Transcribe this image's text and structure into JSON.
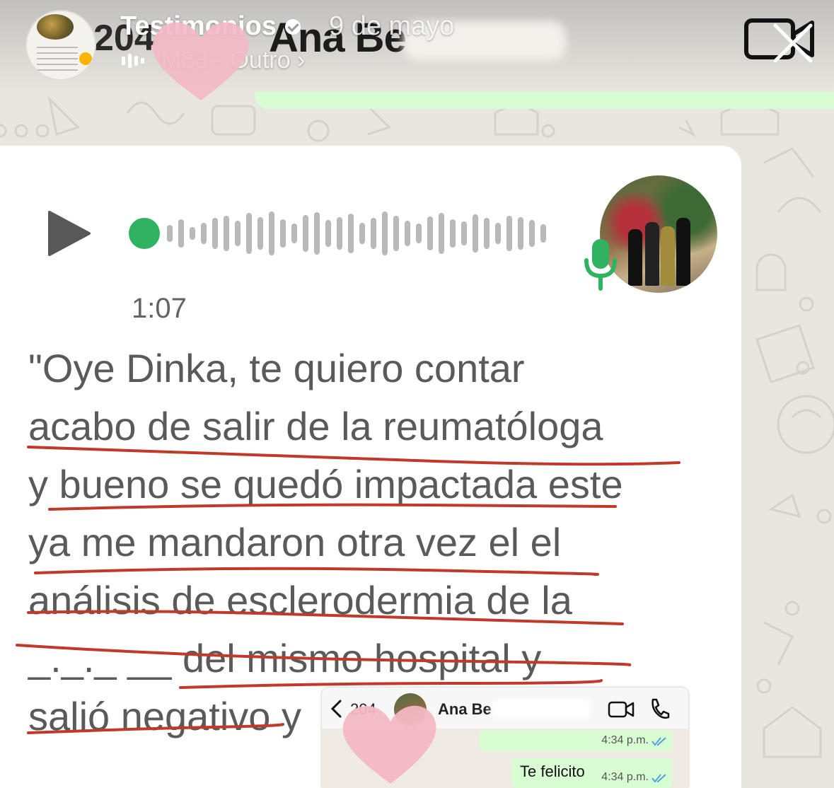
{
  "story": {
    "account_name": "Testimonios",
    "date": "9 de mayo",
    "music_artist": "M83",
    "music_track": "Outro ›",
    "background_header_number": "204",
    "background_contact_name": "Ana Be"
  },
  "voice_message": {
    "duration": "1:07",
    "transcript_lines": [
      "\"Oye Dinka, te quiero contar",
      "acabo de salir de la reumatóloga",
      "y bueno se quedó impactada este",
      "ya me mandaron otra vez el el",
      "análisis de esclerodermia de la",
      "_._._ __ del mismo hospital y",
      "salió negativo y"
    ]
  },
  "inset_chat": {
    "back_count": "204",
    "contact_name": "Ana Be",
    "messages": [
      {
        "text": "",
        "time": "4:34 p.m."
      },
      {
        "text": "Te felicito",
        "time": "4:34 p.m."
      }
    ]
  },
  "colors": {
    "whatsapp_green": "#25d366",
    "outgoing_bubble": "#d9fdd3",
    "underline_red": "#c0392b",
    "read_ticks": "#4fa3e0",
    "heart_pink": "#f3b8c4"
  }
}
